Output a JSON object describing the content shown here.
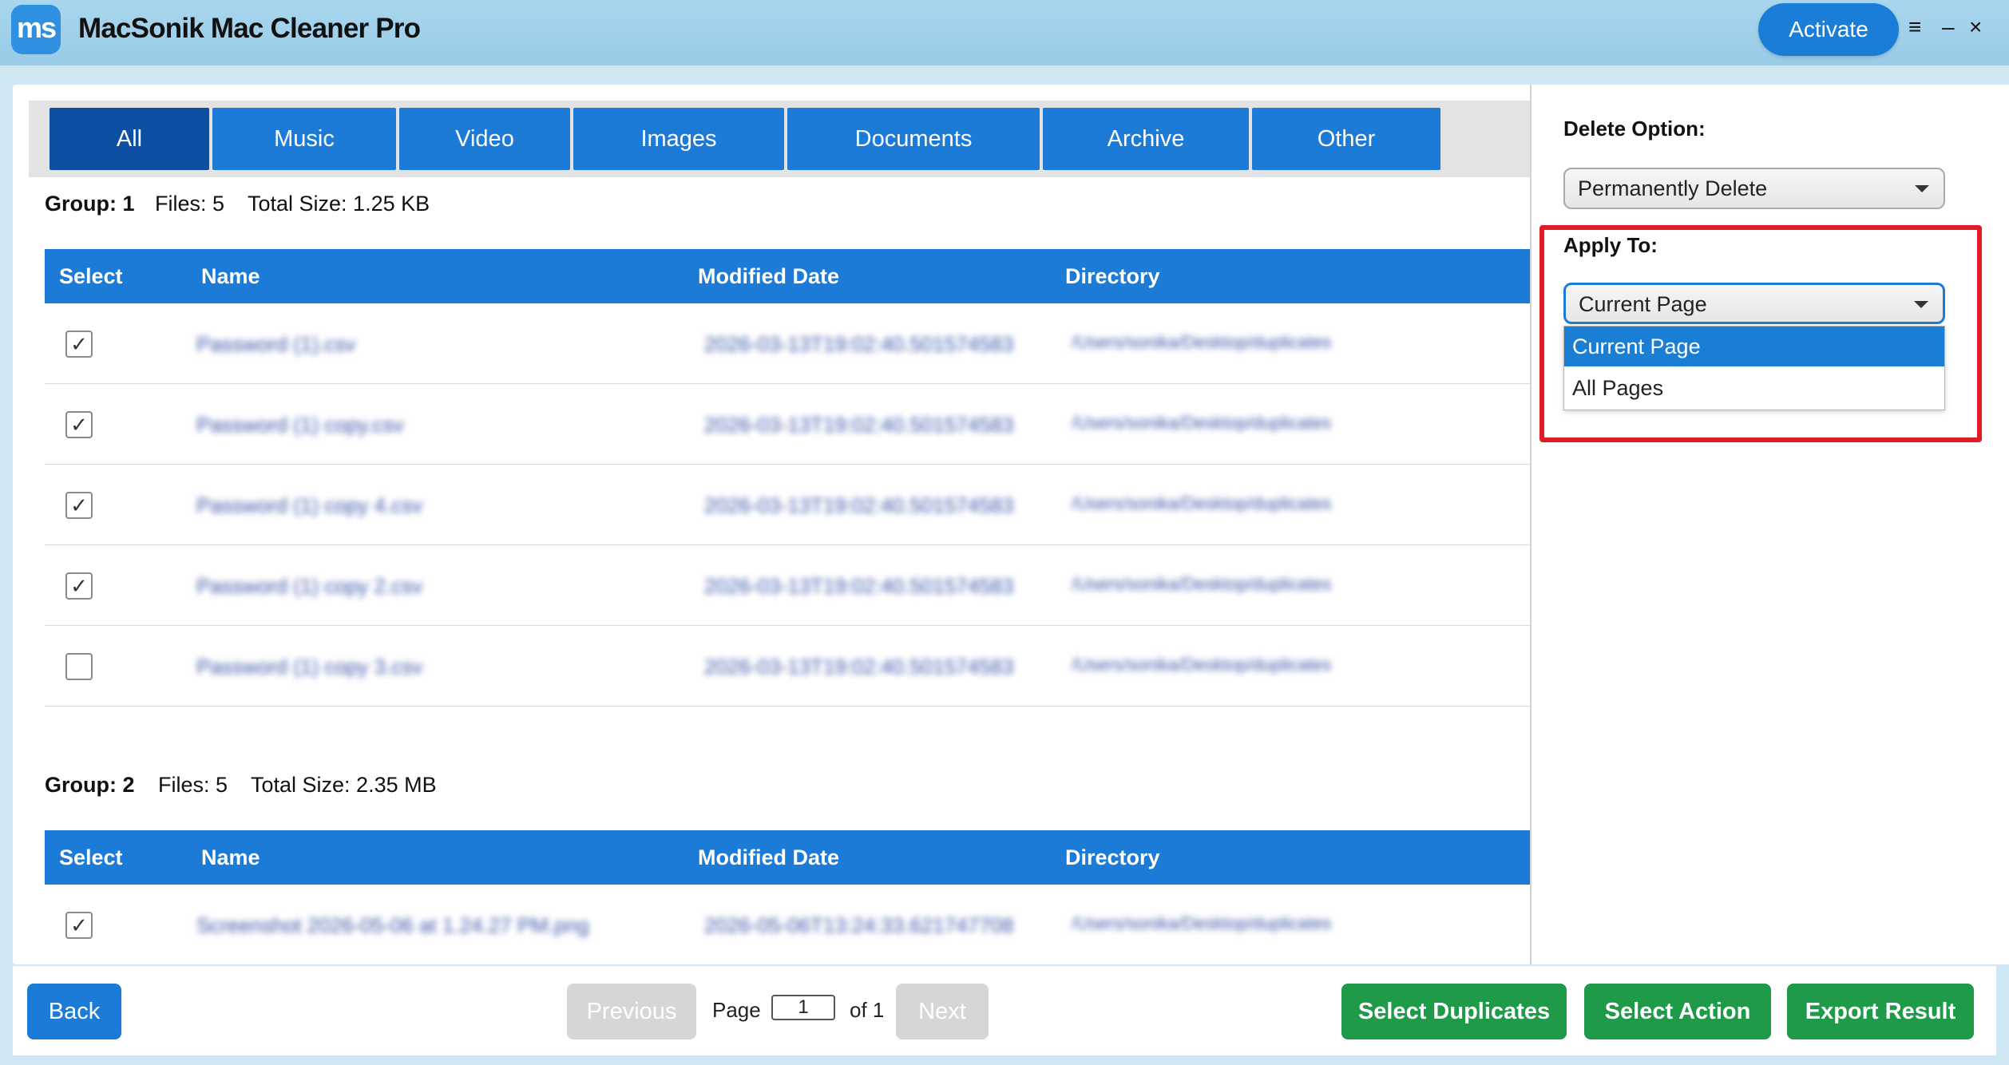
{
  "app": {
    "logo_text": "ms",
    "title": "MacSonik Mac Cleaner Pro",
    "activate_label": "Activate",
    "menu_icon": "≡",
    "minimize_icon": "–",
    "close_icon": "×"
  },
  "tabs": [
    {
      "label": "All",
      "active": true
    },
    {
      "label": "Music"
    },
    {
      "label": "Video"
    },
    {
      "label": "Images"
    },
    {
      "label": "Documents"
    },
    {
      "label": "Archive"
    },
    {
      "label": "Other"
    }
  ],
  "columns": {
    "select": "Select",
    "name": "Name",
    "modified": "Modified Date",
    "directory": "Directory"
  },
  "groups": [
    {
      "title": "Group: 1",
      "files": "Files: 5",
      "size": "Total Size: 1.25 KB",
      "rows": [
        {
          "checked": true,
          "name": "Password (1).csv",
          "modified": "2026-03-13T19:02:40.501574583",
          "directory": "/Users/sonika/Desktop/duplicates"
        },
        {
          "checked": true,
          "name": "Password (1) copy.csv",
          "modified": "2026-03-13T19:02:40.501574583",
          "directory": "/Users/sonika/Desktop/duplicates"
        },
        {
          "checked": true,
          "name": "Password (1) copy 4.csv",
          "modified": "2026-03-13T19:02:40.501574583",
          "directory": "/Users/sonika/Desktop/duplicates"
        },
        {
          "checked": true,
          "name": "Password (1) copy 2.csv",
          "modified": "2026-03-13T19:02:40.501574583",
          "directory": "/Users/sonika/Desktop/duplicates"
        },
        {
          "checked": false,
          "name": "Password (1) copy 3.csv",
          "modified": "2026-03-13T19:02:40.501574583",
          "directory": "/Users/sonika/Desktop/duplicates"
        }
      ]
    },
    {
      "title": "Group: 2",
      "files": "Files: 5",
      "size": "Total Size: 2.35 MB",
      "rows": [
        {
          "checked": true,
          "name": "Screenshot 2026-05-06 at 1.24.27 PM.png",
          "modified": "2026-05-06T13:24:33.621747708",
          "directory": "/Users/sonika/Desktop/duplicates"
        }
      ]
    }
  ],
  "side_panel": {
    "delete_option_label": "Delete Option:",
    "delete_option_value": "Permanently Delete",
    "apply_to_label": "Apply To:",
    "apply_to_value": "Current Page",
    "apply_to_options": [
      "Current Page",
      "All Pages"
    ]
  },
  "footer": {
    "back_label": "Back",
    "previous_label": "Previous",
    "page_label": "Page",
    "page_value": "1",
    "of_label": "of 1",
    "next_label": "Next",
    "select_duplicates_label": "Select Duplicates",
    "select_action_label": "Select Action",
    "export_label": "Export Result"
  },
  "colors": {
    "primary": "#1b7bd6",
    "tab_active": "#0d4fa3",
    "action_green": "#1f9a49",
    "highlight_red": "#e01b24"
  }
}
